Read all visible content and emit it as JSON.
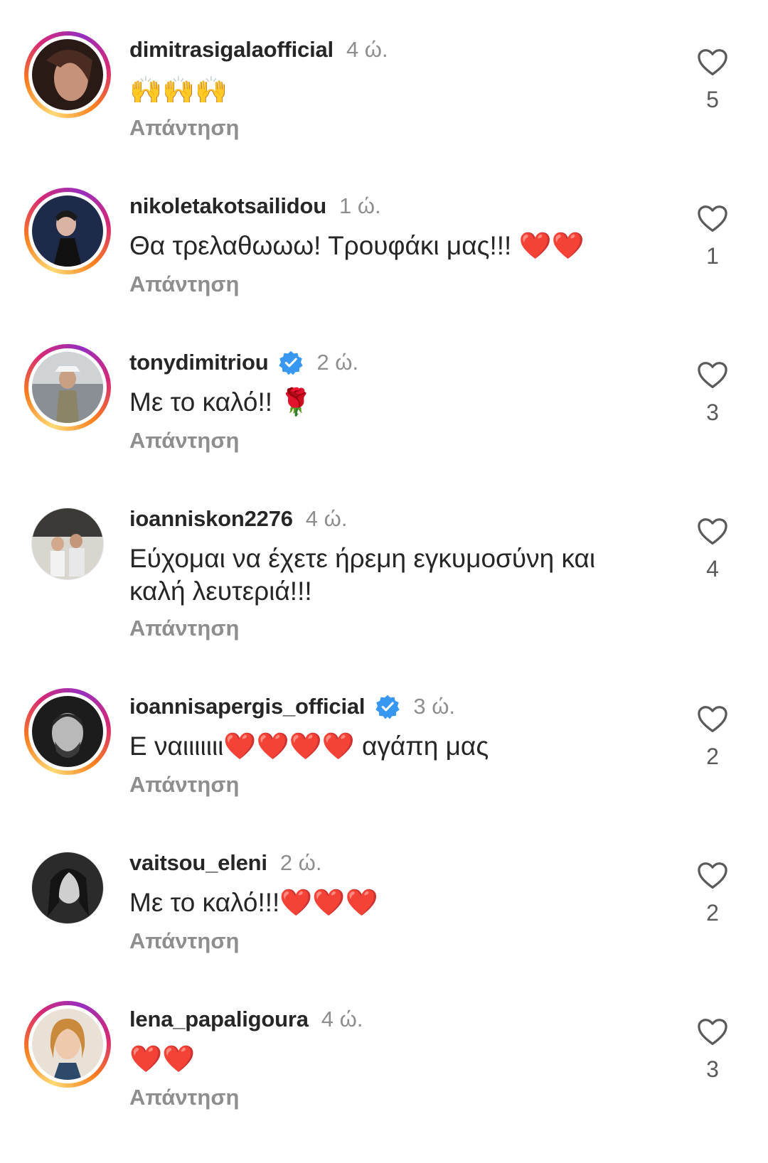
{
  "comments": [
    {
      "username": "dimitrasigalaofficial",
      "verified": false,
      "time": "4 ώ.",
      "text": "🙌🙌🙌",
      "reply": "Απάντηση",
      "likes": "5",
      "avatar_ring": "story"
    },
    {
      "username": "nikoletakotsailidou",
      "verified": false,
      "time": "1 ώ.",
      "text": "Θα τρελαθωωω! Τρουφάκι μας!!! ❤️❤️",
      "reply": "Απάντηση",
      "likes": "1",
      "avatar_ring": "story"
    },
    {
      "username": "tonydimitriou",
      "verified": true,
      "time": "2 ώ.",
      "text": "Με το καλό!! 🌹",
      "reply": "Απάντηση",
      "likes": "3",
      "avatar_ring": "story"
    },
    {
      "username": "ioanniskon2276",
      "verified": false,
      "time": "4 ώ.",
      "text": "Εύχομαι να έχετε ήρεμη εγκυμοσύνη και καλή λευτεριά!!!",
      "reply": "Απάντηση",
      "likes": "4",
      "avatar_ring": "plain"
    },
    {
      "username": "ioannisapergis_official",
      "verified": true,
      "time": "3 ώ.",
      "text": "Ε ναιιιιιιι❤️❤️❤️❤️ αγάπη μας",
      "reply": "Απάντηση",
      "likes": "2",
      "avatar_ring": "story"
    },
    {
      "username": "vaitsou_eleni",
      "verified": false,
      "time": "2 ώ.",
      "text": "Με το καλό!!!❤️❤️❤️",
      "reply": "Απάντηση",
      "likes": "2",
      "avatar_ring": "plain"
    },
    {
      "username": "lena_papaligoura",
      "verified": false,
      "time": "4 ώ.",
      "text": "❤️❤️",
      "reply": "Απάντηση",
      "likes": "3",
      "avatar_ring": "story"
    }
  ],
  "colors": {
    "username": "#262626",
    "secondary": "#8e8e8e",
    "verified": "#3897f0",
    "heart_emoji": "#e0202b"
  },
  "icons": {
    "like": "heart-outline-icon",
    "verified": "verified-badge-icon"
  }
}
